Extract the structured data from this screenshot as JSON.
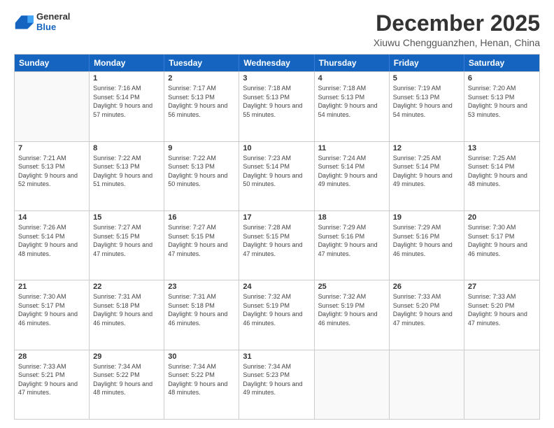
{
  "header": {
    "logo_general": "General",
    "logo_blue": "Blue",
    "month_year": "December 2025",
    "location": "Xiuwu Chengguanzhen, Henan, China"
  },
  "weekdays": [
    "Sunday",
    "Monday",
    "Tuesday",
    "Wednesday",
    "Thursday",
    "Friday",
    "Saturday"
  ],
  "weeks": [
    [
      {
        "day": "",
        "sunrise": "",
        "sunset": "",
        "daylight": "",
        "empty": true
      },
      {
        "day": "1",
        "sunrise": "Sunrise: 7:16 AM",
        "sunset": "Sunset: 5:14 PM",
        "daylight": "Daylight: 9 hours and 57 minutes."
      },
      {
        "day": "2",
        "sunrise": "Sunrise: 7:17 AM",
        "sunset": "Sunset: 5:13 PM",
        "daylight": "Daylight: 9 hours and 56 minutes."
      },
      {
        "day": "3",
        "sunrise": "Sunrise: 7:18 AM",
        "sunset": "Sunset: 5:13 PM",
        "daylight": "Daylight: 9 hours and 55 minutes."
      },
      {
        "day": "4",
        "sunrise": "Sunrise: 7:18 AM",
        "sunset": "Sunset: 5:13 PM",
        "daylight": "Daylight: 9 hours and 54 minutes."
      },
      {
        "day": "5",
        "sunrise": "Sunrise: 7:19 AM",
        "sunset": "Sunset: 5:13 PM",
        "daylight": "Daylight: 9 hours and 54 minutes."
      },
      {
        "day": "6",
        "sunrise": "Sunrise: 7:20 AM",
        "sunset": "Sunset: 5:13 PM",
        "daylight": "Daylight: 9 hours and 53 minutes."
      }
    ],
    [
      {
        "day": "7",
        "sunrise": "Sunrise: 7:21 AM",
        "sunset": "Sunset: 5:13 PM",
        "daylight": "Daylight: 9 hours and 52 minutes."
      },
      {
        "day": "8",
        "sunrise": "Sunrise: 7:22 AM",
        "sunset": "Sunset: 5:13 PM",
        "daylight": "Daylight: 9 hours and 51 minutes."
      },
      {
        "day": "9",
        "sunrise": "Sunrise: 7:22 AM",
        "sunset": "Sunset: 5:13 PM",
        "daylight": "Daylight: 9 hours and 50 minutes."
      },
      {
        "day": "10",
        "sunrise": "Sunrise: 7:23 AM",
        "sunset": "Sunset: 5:14 PM",
        "daylight": "Daylight: 9 hours and 50 minutes."
      },
      {
        "day": "11",
        "sunrise": "Sunrise: 7:24 AM",
        "sunset": "Sunset: 5:14 PM",
        "daylight": "Daylight: 9 hours and 49 minutes."
      },
      {
        "day": "12",
        "sunrise": "Sunrise: 7:25 AM",
        "sunset": "Sunset: 5:14 PM",
        "daylight": "Daylight: 9 hours and 49 minutes."
      },
      {
        "day": "13",
        "sunrise": "Sunrise: 7:25 AM",
        "sunset": "Sunset: 5:14 PM",
        "daylight": "Daylight: 9 hours and 48 minutes."
      }
    ],
    [
      {
        "day": "14",
        "sunrise": "Sunrise: 7:26 AM",
        "sunset": "Sunset: 5:14 PM",
        "daylight": "Daylight: 9 hours and 48 minutes."
      },
      {
        "day": "15",
        "sunrise": "Sunrise: 7:27 AM",
        "sunset": "Sunset: 5:15 PM",
        "daylight": "Daylight: 9 hours and 47 minutes."
      },
      {
        "day": "16",
        "sunrise": "Sunrise: 7:27 AM",
        "sunset": "Sunset: 5:15 PM",
        "daylight": "Daylight: 9 hours and 47 minutes."
      },
      {
        "day": "17",
        "sunrise": "Sunrise: 7:28 AM",
        "sunset": "Sunset: 5:15 PM",
        "daylight": "Daylight: 9 hours and 47 minutes."
      },
      {
        "day": "18",
        "sunrise": "Sunrise: 7:29 AM",
        "sunset": "Sunset: 5:16 PM",
        "daylight": "Daylight: 9 hours and 47 minutes."
      },
      {
        "day": "19",
        "sunrise": "Sunrise: 7:29 AM",
        "sunset": "Sunset: 5:16 PM",
        "daylight": "Daylight: 9 hours and 46 minutes."
      },
      {
        "day": "20",
        "sunrise": "Sunrise: 7:30 AM",
        "sunset": "Sunset: 5:17 PM",
        "daylight": "Daylight: 9 hours and 46 minutes."
      }
    ],
    [
      {
        "day": "21",
        "sunrise": "Sunrise: 7:30 AM",
        "sunset": "Sunset: 5:17 PM",
        "daylight": "Daylight: 9 hours and 46 minutes."
      },
      {
        "day": "22",
        "sunrise": "Sunrise: 7:31 AM",
        "sunset": "Sunset: 5:18 PM",
        "daylight": "Daylight: 9 hours and 46 minutes."
      },
      {
        "day": "23",
        "sunrise": "Sunrise: 7:31 AM",
        "sunset": "Sunset: 5:18 PM",
        "daylight": "Daylight: 9 hours and 46 minutes."
      },
      {
        "day": "24",
        "sunrise": "Sunrise: 7:32 AM",
        "sunset": "Sunset: 5:19 PM",
        "daylight": "Daylight: 9 hours and 46 minutes."
      },
      {
        "day": "25",
        "sunrise": "Sunrise: 7:32 AM",
        "sunset": "Sunset: 5:19 PM",
        "daylight": "Daylight: 9 hours and 46 minutes."
      },
      {
        "day": "26",
        "sunrise": "Sunrise: 7:33 AM",
        "sunset": "Sunset: 5:20 PM",
        "daylight": "Daylight: 9 hours and 47 minutes."
      },
      {
        "day": "27",
        "sunrise": "Sunrise: 7:33 AM",
        "sunset": "Sunset: 5:20 PM",
        "daylight": "Daylight: 9 hours and 47 minutes."
      }
    ],
    [
      {
        "day": "28",
        "sunrise": "Sunrise: 7:33 AM",
        "sunset": "Sunset: 5:21 PM",
        "daylight": "Daylight: 9 hours and 47 minutes."
      },
      {
        "day": "29",
        "sunrise": "Sunrise: 7:34 AM",
        "sunset": "Sunset: 5:22 PM",
        "daylight": "Daylight: 9 hours and 48 minutes."
      },
      {
        "day": "30",
        "sunrise": "Sunrise: 7:34 AM",
        "sunset": "Sunset: 5:22 PM",
        "daylight": "Daylight: 9 hours and 48 minutes."
      },
      {
        "day": "31",
        "sunrise": "Sunrise: 7:34 AM",
        "sunset": "Sunset: 5:23 PM",
        "daylight": "Daylight: 9 hours and 49 minutes."
      },
      {
        "day": "",
        "sunrise": "",
        "sunset": "",
        "daylight": "",
        "empty": true
      },
      {
        "day": "",
        "sunrise": "",
        "sunset": "",
        "daylight": "",
        "empty": true
      },
      {
        "day": "",
        "sunrise": "",
        "sunset": "",
        "daylight": "",
        "empty": true
      }
    ]
  ]
}
